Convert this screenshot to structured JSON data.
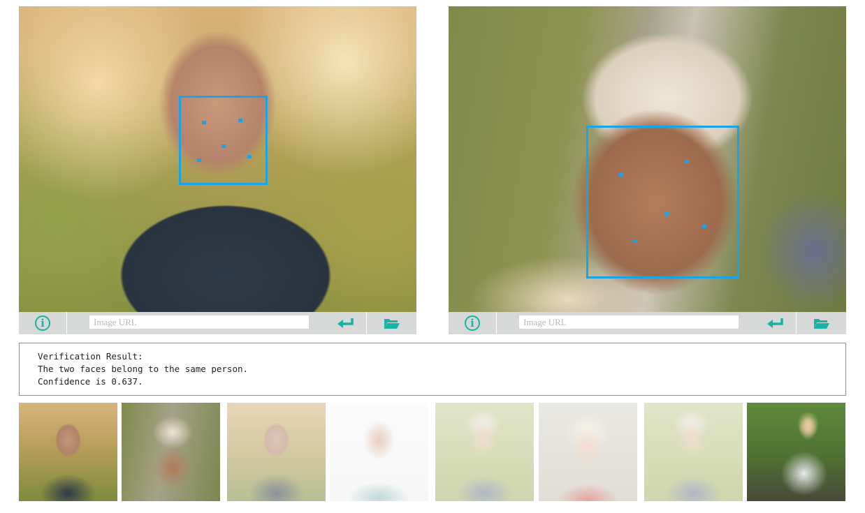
{
  "panels": [
    {
      "id": "left",
      "photo_description_icon": "person-photo",
      "url_placeholder": "Image URL",
      "url_value": ""
    },
    {
      "id": "right",
      "photo_description_icon": "person-photo",
      "url_placeholder": "Image URL",
      "url_value": ""
    }
  ],
  "toolbar": {
    "info_glyph": "i",
    "icons": [
      "info-icon",
      "enter-icon",
      "folder-open-icon"
    ]
  },
  "result": {
    "line1": "Verification Result:",
    "line2": "The two faces belong to the same person.",
    "line3": "Confidence is 0.637.",
    "confidence": 0.637
  },
  "thumbnails": [
    {
      "subject": "man-1",
      "faded": false
    },
    {
      "subject": "man-1-beanie",
      "faded": false
    },
    {
      "subject": "man-1",
      "faded": true
    },
    {
      "subject": "man-2",
      "faded": true
    },
    {
      "subject": "woman-1",
      "faded": true
    },
    {
      "subject": "woman-2",
      "faded": true
    },
    {
      "subject": "woman-1",
      "faded": true
    },
    {
      "subject": "woman-3",
      "faded": false
    }
  ],
  "colors": {
    "accent_teal": "#17b3a4",
    "face_box_blue": "#1aa3e6",
    "toolbar_gray": "#d7d8d8"
  }
}
